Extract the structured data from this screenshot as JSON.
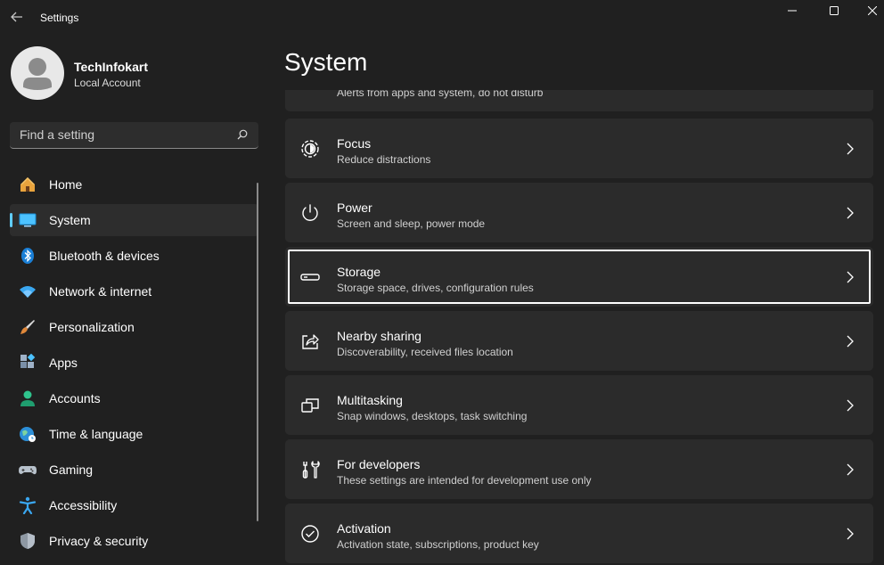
{
  "window": {
    "title": "Settings"
  },
  "profile": {
    "name": "TechInfokart",
    "account_type": "Local Account"
  },
  "search": {
    "placeholder": "Find a setting"
  },
  "sidebar": {
    "items": [
      {
        "label": "Home",
        "icon": "home-icon"
      },
      {
        "label": "System",
        "icon": "system-icon",
        "selected": true
      },
      {
        "label": "Bluetooth & devices",
        "icon": "bluetooth-icon"
      },
      {
        "label": "Network & internet",
        "icon": "wifi-icon"
      },
      {
        "label": "Personalization",
        "icon": "brush-icon"
      },
      {
        "label": "Apps",
        "icon": "apps-icon"
      },
      {
        "label": "Accounts",
        "icon": "accounts-icon"
      },
      {
        "label": "Time & language",
        "icon": "globe-icon"
      },
      {
        "label": "Gaming",
        "icon": "gamepad-icon"
      },
      {
        "label": "Accessibility",
        "icon": "accessibility-icon"
      },
      {
        "label": "Privacy & security",
        "icon": "shield-icon"
      }
    ]
  },
  "main": {
    "title": "System",
    "partial_card_subtitle": "Alerts from apps and system, do not disturb",
    "cards": [
      {
        "title": "Focus",
        "subtitle": "Reduce distractions",
        "icon": "focus-icon"
      },
      {
        "title": "Power",
        "subtitle": "Screen and sleep, power mode",
        "icon": "power-icon"
      },
      {
        "title": "Storage",
        "subtitle": "Storage space, drives, configuration rules",
        "icon": "storage-icon",
        "highlighted": true
      },
      {
        "title": "Nearby sharing",
        "subtitle": "Discoverability, received files location",
        "icon": "share-icon"
      },
      {
        "title": "Multitasking",
        "subtitle": "Snap windows, desktops, task switching",
        "icon": "multitasking-icon"
      },
      {
        "title": "For developers",
        "subtitle": "These settings are intended for development use only",
        "icon": "developer-tools-icon"
      },
      {
        "title": "Activation",
        "subtitle": "Activation state, subscriptions, product key",
        "icon": "activation-icon"
      }
    ]
  },
  "colors": {
    "accent": "#60cdff",
    "background": "#202020",
    "card": "#2b2b2b",
    "selected": "#2d2d2d"
  }
}
